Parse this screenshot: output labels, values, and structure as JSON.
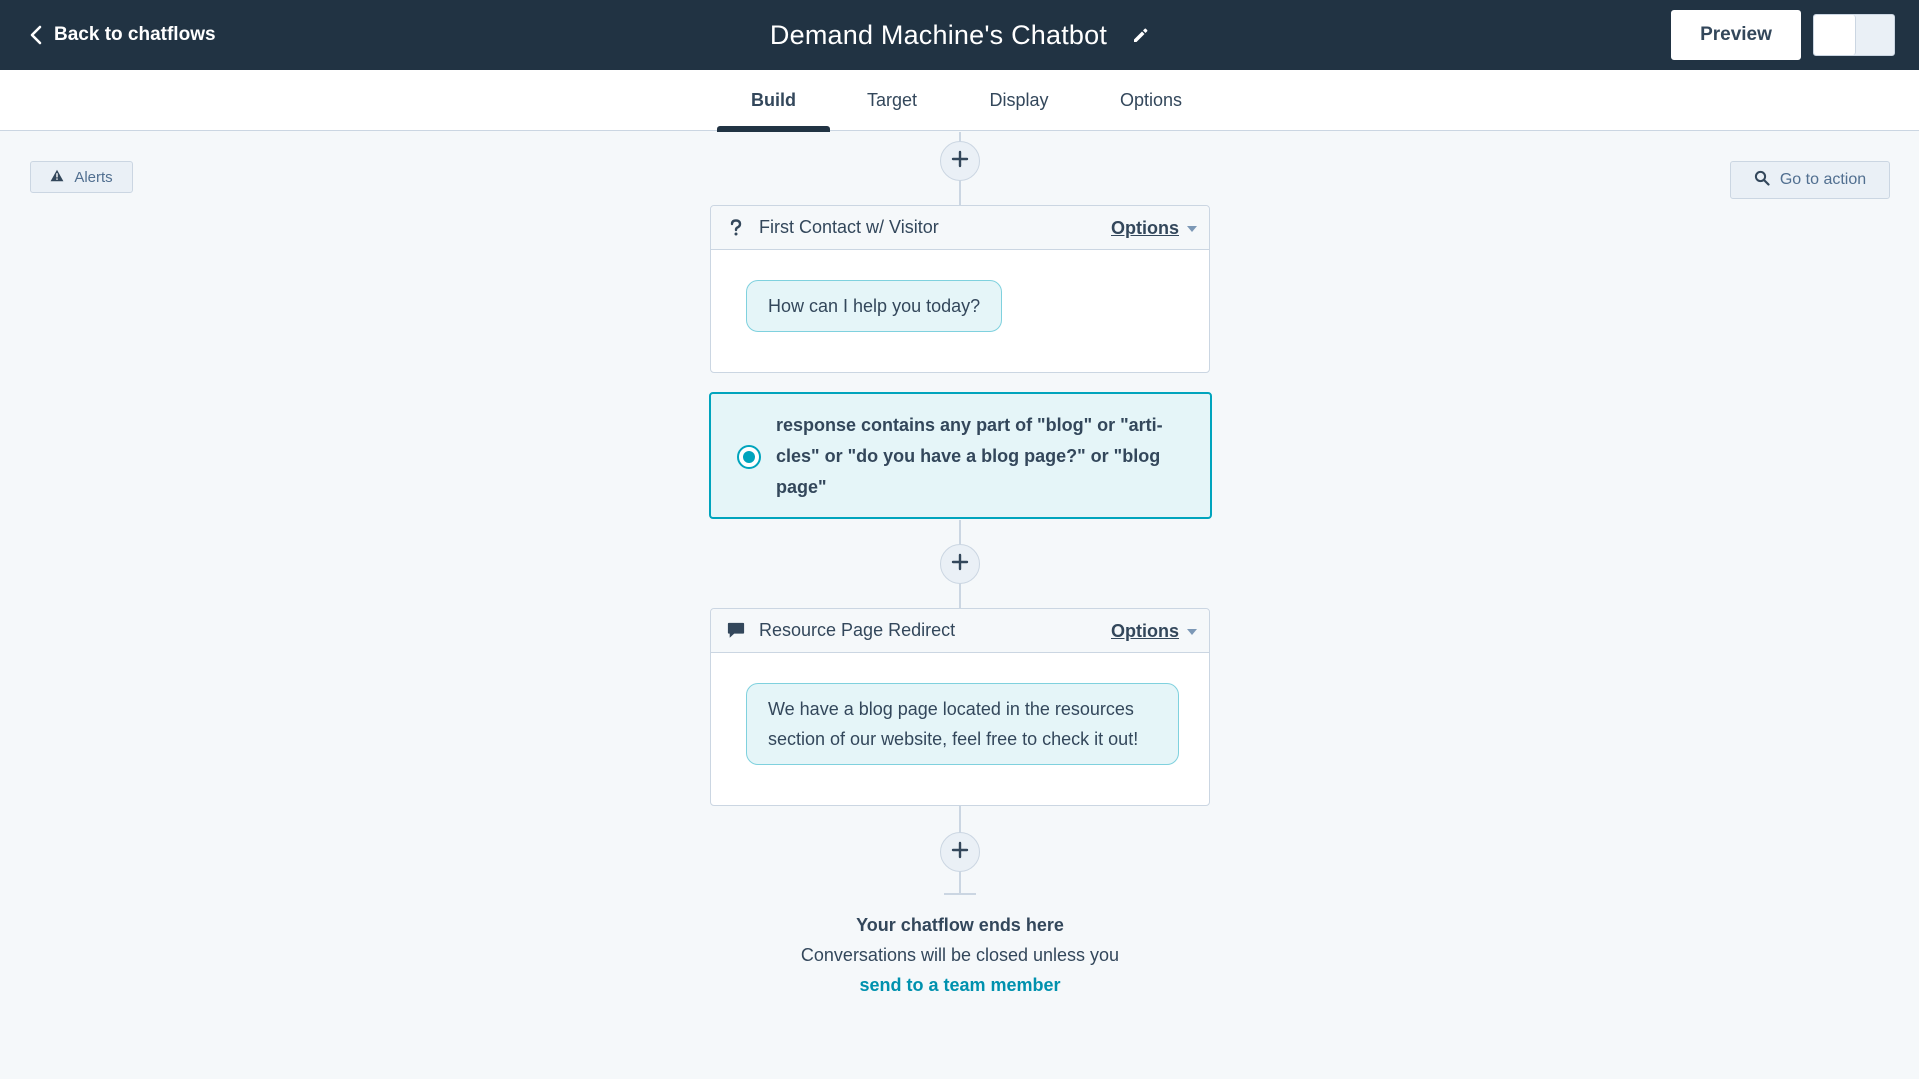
{
  "header": {
    "back_label": "Back to chatflows",
    "title": "Demand Machine's Chatbot",
    "preview_label": "Preview"
  },
  "tabs": [
    {
      "label": "Build",
      "active": true
    },
    {
      "label": "Target",
      "active": false
    },
    {
      "label": "Display",
      "active": false
    },
    {
      "label": "Options",
      "active": false
    }
  ],
  "toolbar": {
    "alerts_label": "Alerts",
    "go_to_action_label": "Go to action"
  },
  "flow": {
    "actions": [
      {
        "title": "First Contact w/ Visitor",
        "icon": "question-icon",
        "options_label": "Options",
        "message": "How can I help you today?"
      },
      {
        "title": "Resource Page Redirect",
        "icon": "chat-bubble-icon",
        "options_label": "Options",
        "message_line1": "We have a blog page located in the resources",
        "message_line2": "section of our website, feel free to check it out!"
      }
    ],
    "branch": {
      "line1": "response contains any part of \"blog\" or \"arti-",
      "line2": "cles\" or \"do you have a blog page?\" or \"blog",
      "line3": "page\""
    },
    "end": {
      "title": "Your chatflow ends here",
      "description": "Conversations will be closed unless you",
      "link": "send to a team member"
    }
  },
  "colors": {
    "topbar": "#213343",
    "accent": "#00a4bd",
    "link": "#0091ae",
    "bubble_bg": "#e5f5f8"
  }
}
